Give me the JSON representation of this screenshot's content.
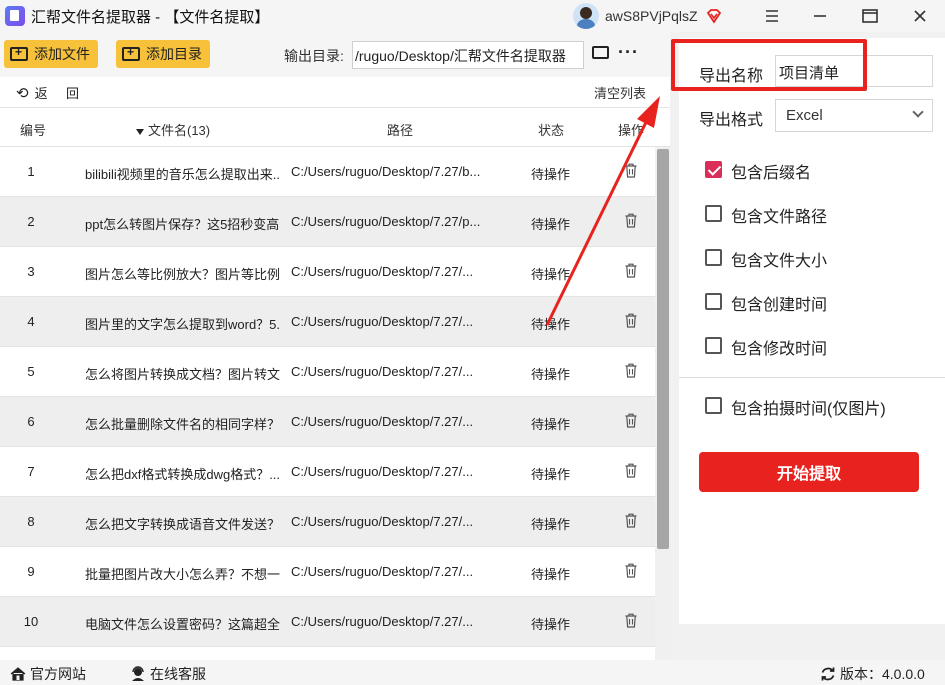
{
  "window": {
    "title": "汇帮文件名提取器 - 【文件名提取】",
    "username": "awS8PVjPqlsZ"
  },
  "toolbar": {
    "add_file": "添加文件",
    "add_dir": "添加目录",
    "output_label": "输出目录:",
    "output_path": "/ruguo/Desktop/汇帮文件名提取器"
  },
  "subbar": {
    "back": "返",
    "hui": "回",
    "clear": "清空列表"
  },
  "table": {
    "headers": {
      "no": "编号",
      "name": "文件名(13)",
      "path": "路径",
      "status": "状态",
      "action": "操作"
    },
    "rows": [
      {
        "no": "1",
        "name": "bilibili视频里的音乐怎么提取出来...",
        "path": "C:/Users/ruguo/Desktop/7.27/b...",
        "status": "待操作"
      },
      {
        "no": "2",
        "name": "ppt怎么转图片保存？这5招秒变高...",
        "path": "C:/Users/ruguo/Desktop/7.27/p...",
        "status": "待操作"
      },
      {
        "no": "3",
        "name": "图片怎么等比例放大？图片等比例...",
        "path": "C:/Users/ruguo/Desktop/7.27/...",
        "status": "待操作"
      },
      {
        "no": "4",
        "name": "图片里的文字怎么提取到word？5...",
        "path": "C:/Users/ruguo/Desktop/7.27/...",
        "status": "待操作"
      },
      {
        "no": "5",
        "name": "怎么将图片转换成文档？图片转文...",
        "path": "C:/Users/ruguo/Desktop/7.27/...",
        "status": "待操作"
      },
      {
        "no": "6",
        "name": "怎么批量删除文件名的相同字样？...",
        "path": "C:/Users/ruguo/Desktop/7.27/...",
        "status": "待操作"
      },
      {
        "no": "7",
        "name": "怎么把dxf格式转换成dwg格式？...",
        "path": "C:/Users/ruguo/Desktop/7.27/...",
        "status": "待操作"
      },
      {
        "no": "8",
        "name": "怎么把文字转换成语音文件发送？...",
        "path": "C:/Users/ruguo/Desktop/7.27/...",
        "status": "待操作"
      },
      {
        "no": "9",
        "name": "批量把图片改大小怎么弄？不想一...",
        "path": "C:/Users/ruguo/Desktop/7.27/...",
        "status": "待操作"
      },
      {
        "no": "10",
        "name": "电脑文件怎么设置密码？这篇超全...",
        "path": "C:/Users/ruguo/Desktop/7.27/...",
        "status": "待操作"
      }
    ]
  },
  "export": {
    "name_label": "导出名称",
    "name_value": "项目清单",
    "format_label": "导出格式",
    "format_value": "Excel",
    "options": [
      {
        "label": "包含后缀名",
        "checked": true
      },
      {
        "label": "包含文件路径",
        "checked": false
      },
      {
        "label": "包含文件大小",
        "checked": false
      },
      {
        "label": "包含创建时间",
        "checked": false
      },
      {
        "label": "包含修改时间",
        "checked": false
      },
      {
        "label": "包含拍摄时间(仅图片)",
        "checked": false
      }
    ],
    "start_button": "开始提取",
    "accent_color": "#e8231f"
  },
  "footer": {
    "website": "官方网站",
    "support": "在线客服",
    "version_label": "版本：",
    "version": "4.0.0.0"
  }
}
